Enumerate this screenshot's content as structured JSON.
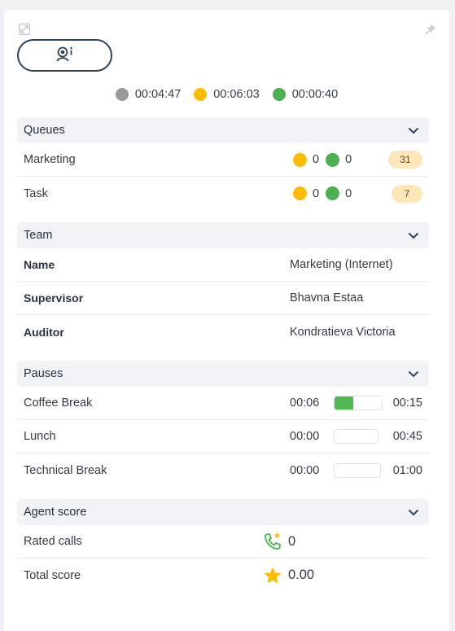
{
  "status_timers": [
    {
      "color": "#9a9a9a",
      "time": "00:04:47"
    },
    {
      "color": "#fbbc05",
      "time": "00:06:03"
    },
    {
      "color": "#4caf50",
      "time": "00:00:40"
    }
  ],
  "queues": {
    "title": "Queues",
    "items": [
      {
        "name": "Marketing",
        "yellow": "0",
        "green": "0",
        "count": "31"
      },
      {
        "name": "Task",
        "yellow": "0",
        "green": "0",
        "count": "7"
      }
    ]
  },
  "team": {
    "title": "Team",
    "rows": [
      {
        "label": "Name",
        "value": "Marketing (Internet)"
      },
      {
        "label": "Supervisor",
        "value": "Bhavna Estaa"
      },
      {
        "label": "Auditor",
        "value": "Kondratieva Victoria"
      }
    ]
  },
  "pauses": {
    "title": "Pauses",
    "items": [
      {
        "name": "Coffee Break",
        "used": "00:06",
        "limit": "00:15",
        "progress": 0.4
      },
      {
        "name": "Lunch",
        "used": "00:00",
        "limit": "00:45",
        "progress": 0
      },
      {
        "name": "Technical Break",
        "used": "00:00",
        "limit": "01:00",
        "progress": 0
      }
    ]
  },
  "agent_score": {
    "title": "Agent score",
    "rated_calls_label": "Rated calls",
    "rated_calls_value": "0",
    "total_score_label": "Total score",
    "total_score_value": "0.00"
  },
  "colors": {
    "accent_dark": "#2c4257",
    "yellow": "#fbbc05",
    "green": "#4caf50",
    "grey": "#9a9a9a",
    "badge_bg": "#fde6b8"
  },
  "icons": {
    "top_left": "collapse-icon",
    "top_right": "pin-icon",
    "agent": "agent-info-icon",
    "section": "chevron-down-icon",
    "rated_calls": "phone-star-icon",
    "total_score": "star-icon"
  }
}
